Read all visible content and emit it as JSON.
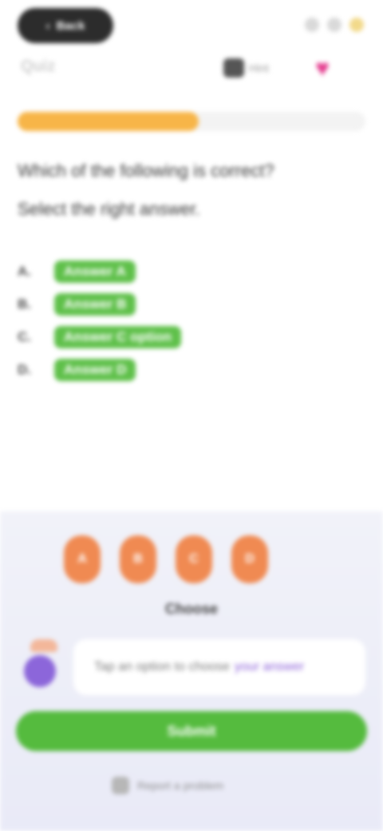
{
  "top_bar": {
    "back_label": "Back",
    "title": "Quiz",
    "toolbar_label": "Hint"
  },
  "progress": {
    "value": 0.52
  },
  "question": {
    "line1": "Which of the following is correct?",
    "line2": "Select the right answer."
  },
  "options": [
    {
      "key": "A.",
      "value": "Answer A"
    },
    {
      "key": "B.",
      "value": "Answer B"
    },
    {
      "key": "C.",
      "value": "Answer C option"
    },
    {
      "key": "D.",
      "value": "Answer D"
    }
  ],
  "bottom": {
    "tokens": [
      "A",
      "B",
      "C",
      "D"
    ],
    "token_caption": "Choose",
    "speech_text": "Tap an option to choose",
    "speech_highlight": "your answer",
    "cta_label": "Submit",
    "footnote": "Report a problem"
  },
  "colors": {
    "accent": "#f7b548",
    "correct": "#5fc04a",
    "cta": "#55bb3e",
    "heart": "#e43c8e",
    "mascot": "#8c66da",
    "token": "#f08a52"
  },
  "icons": {
    "back": "back-icon",
    "heart": "heart-icon",
    "toolbar": "hint-icon",
    "footnote": "report-icon"
  }
}
